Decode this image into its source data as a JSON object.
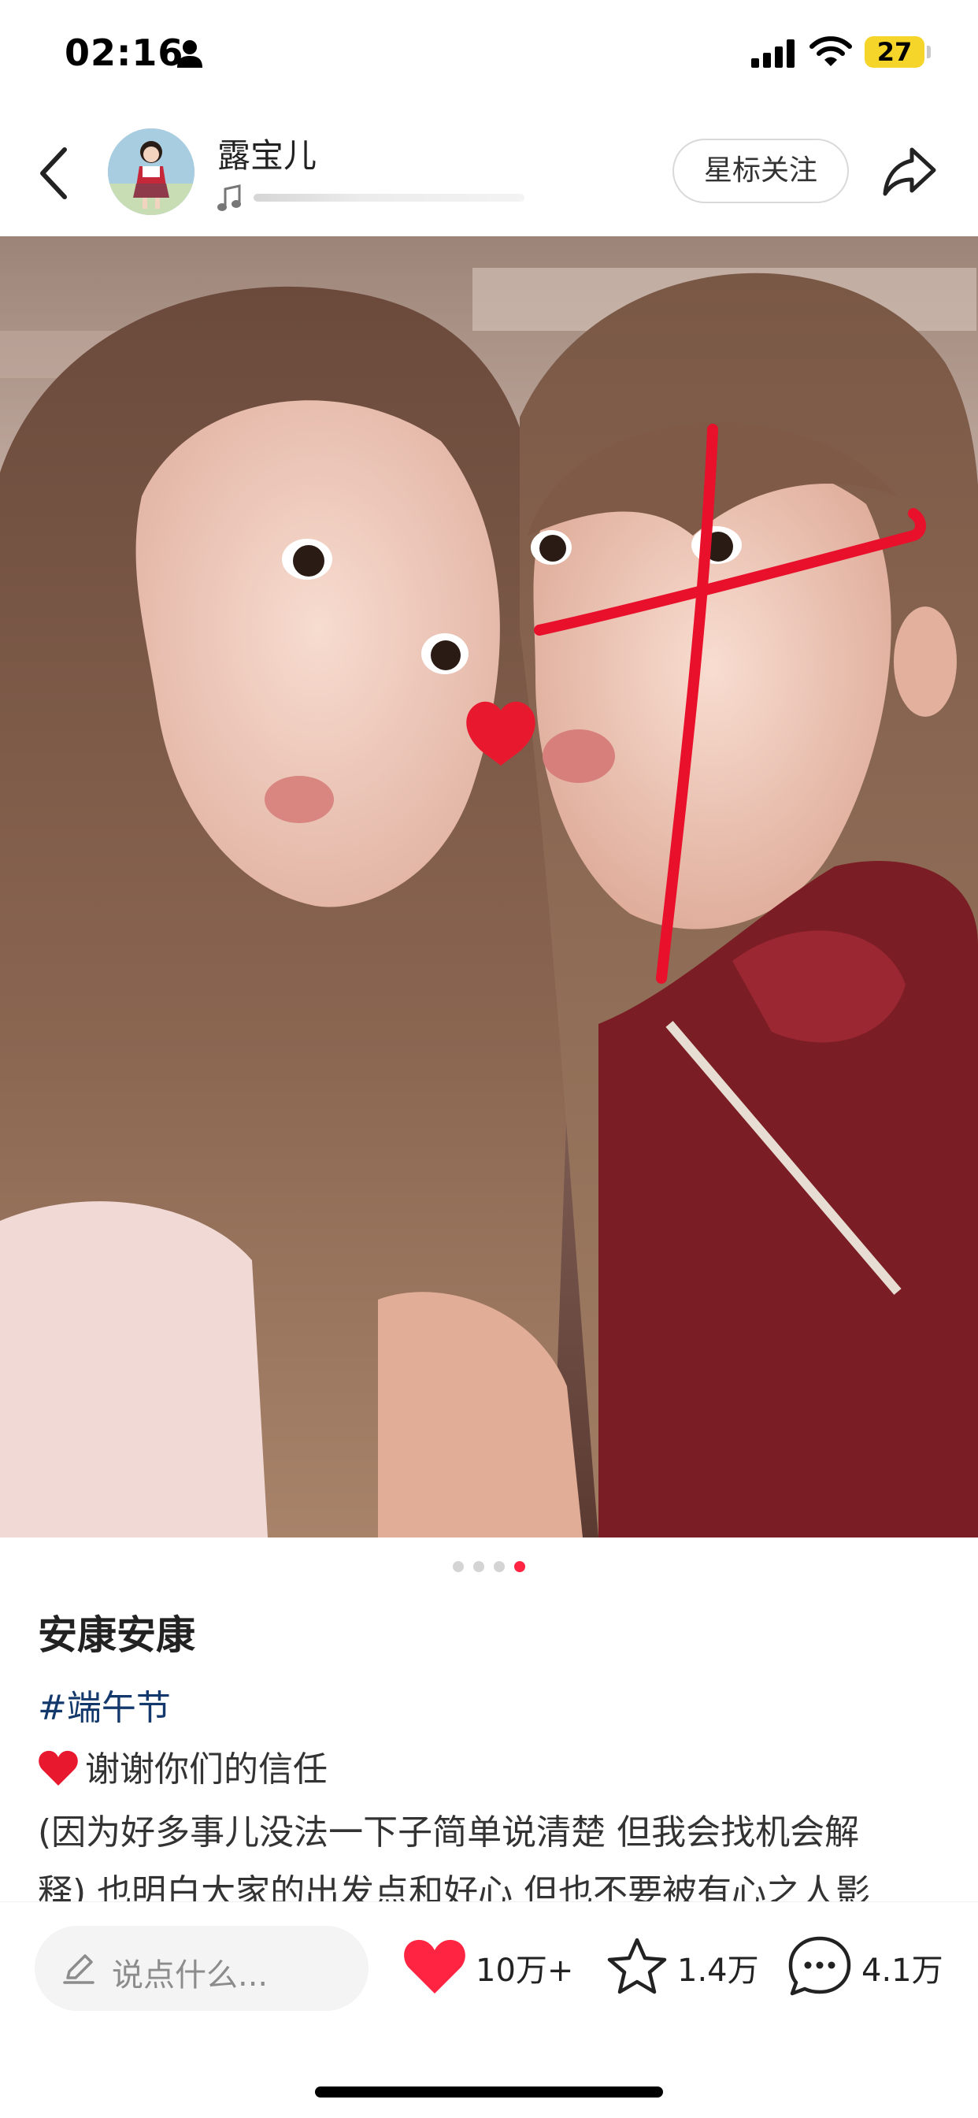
{
  "status_bar": {
    "time": "02:16",
    "battery": "27"
  },
  "header": {
    "author_name": "露宝儿",
    "follow_label": "星标关注"
  },
  "carousel": {
    "total": 4,
    "current": 4
  },
  "note": {
    "title": "安康安康",
    "hashtag": "#端午节",
    "lines": [
      "谢谢你们的信任",
      "(因为好多事儿没法一下子简单说清楚 但我会找机会解",
      "释) 也明白大家的出发点和好心 但也不要被有心之人影"
    ]
  },
  "bottom_bar": {
    "comment_placeholder": "说点什么...",
    "like_count": "10万+",
    "favorite_count": "1.4万",
    "comment_count": "4.1万"
  },
  "colors": {
    "accent": "#ff2442",
    "hashtag": "#13386c",
    "battery": "#f5d52a"
  },
  "icons": [
    "person-icon",
    "signal-icon",
    "wifi-icon",
    "back-icon",
    "music-note-icon",
    "share-icon",
    "pencil-icon",
    "heart-icon",
    "star-icon",
    "comment-icon"
  ]
}
